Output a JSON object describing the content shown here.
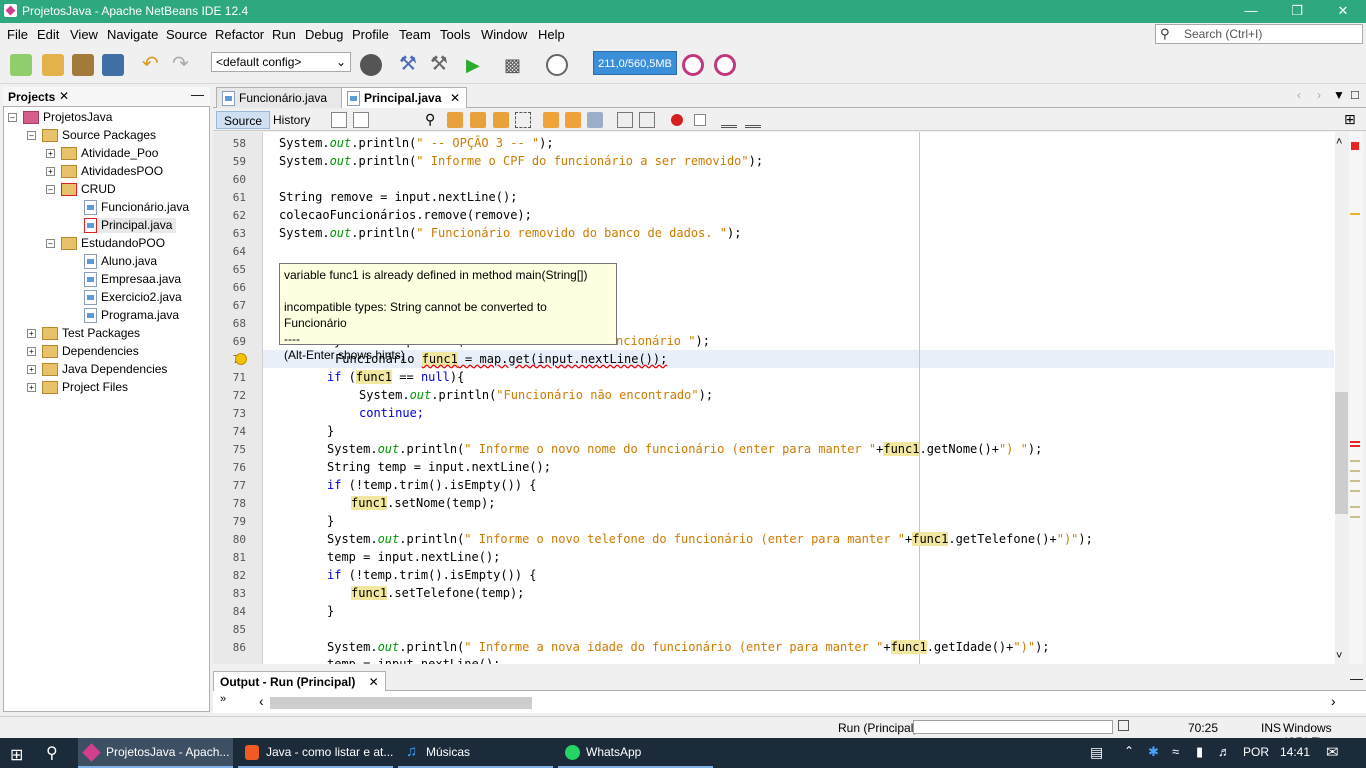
{
  "window": {
    "title": "ProjetosJava - Apache NetBeans IDE 12.4"
  },
  "menu": [
    "File",
    "Edit",
    "View",
    "Navigate",
    "Source",
    "Refactor",
    "Run",
    "Debug",
    "Profile",
    "Team",
    "Tools",
    "Window",
    "Help"
  ],
  "search": {
    "placeholder": "Search (Ctrl+I)"
  },
  "toolbar": {
    "config": "<default config>",
    "memory": "211,0/560,5MB"
  },
  "projects": {
    "tab_label": "Projects",
    "root": "ProjetosJava",
    "source_packages": "Source Packages",
    "packages": [
      "Atividade_Poo",
      "AtividadesPOO",
      "CRUD",
      "EstudandoPOO"
    ],
    "crud_files": [
      "Funcionário.java",
      "Principal.java"
    ],
    "estudando_files": [
      "Aluno.java",
      "Empresaa.java",
      "Exercicio2.java",
      "Programa.java"
    ],
    "others": [
      "Test Packages",
      "Dependencies",
      "Java Dependencies",
      "Project Files"
    ]
  },
  "editor": {
    "tabs": [
      "Funcionário.java",
      "Principal.java"
    ],
    "source_label": "Source",
    "history_label": "History"
  },
  "code": {
    "l58a": "System.",
    "l58b": "out",
    "l58c": ".println(",
    "l58d": "\" -- OPÇÃO 3 -- \"",
    "l58e": ");",
    "l59a": "System.",
    "l59b": "out",
    "l59c": ".println(",
    "l59d": "\" Informe o CPF do funcionário a ser removido\"",
    "l59e": ");",
    "l61": "String remove = input.nextLine();",
    "l62": "colecaoFuncionários.remove(remove);",
    "l63a": "System.",
    "l63b": "out",
    "l63c": ".println(",
    "l63d": "\" Funcionário removido do banco de dados. \"",
    "l63e": ");",
    "l69a": "System.out.println(",
    "l69b": "\" Informe o cod do funcionário \"",
    "l69c": ");",
    "l70a": "Funcionário ",
    "l70b": "func1",
    "l70c": " = map.get(input.nextLine());",
    "l71a": "if",
    "l71b": " (",
    "l71c": "func1",
    "l71d": " == ",
    "l71e": "null",
    "l71f": "){",
    "l72a": "System.",
    "l72b": "out",
    "l72c": ".println(",
    "l72d": "\"Funcionário não encontrado\"",
    "l72e": ");",
    "l73": "continue;",
    "l74": "}",
    "l75a": "System.",
    "l75b": "out",
    "l75c": ".println(",
    "l75d": "\" Informe o novo nome do funcionário (enter para manter \"",
    "l75e": "+",
    "l75f": "func1",
    "l75g": ".getNome()+",
    "l75h": "\") \"",
    "l75i": ");",
    "l76": "String temp = input.nextLine();",
    "l77a": "if",
    "l77b": " (!temp.trim().isEmpty()) {",
    "l78a": "func1",
    "l78b": ".setNome(temp);",
    "l79": "}",
    "l80a": "System.",
    "l80b": "out",
    "l80c": ".println(",
    "l80d": "\" Informe o novo telefone do funcionário (enter para manter \"",
    "l80e": "+",
    "l80f": "func1",
    "l80g": ".getTelefone()+",
    "l80h": "\")\"",
    "l80i": ");",
    "l81": "temp = input.nextLine();",
    "l82a": "if",
    "l82b": " (!temp.trim().isEmpty()) {",
    "l83a": "func1",
    "l83b": ".setTelefone(temp);",
    "l84": "}",
    "l86a": "System.",
    "l86b": "out",
    "l86c": ".println(",
    "l86d": "\" Informe a nova idade do funcionário (enter para manter \"",
    "l86e": "+",
    "l86f": "func1",
    "l86g": ".getIdade()+",
    "l86h": "\")\"",
    "l86i": ");",
    "l87": "temp = input.nextLine();"
  },
  "line_numbers": [
    "58",
    "59",
    "60",
    "61",
    "62",
    "63",
    "64",
    "65",
    "66",
    "67",
    "68",
    "69",
    "70",
    "71",
    "72",
    "73",
    "74",
    "75",
    "76",
    "77",
    "78",
    "79",
    "80",
    "81",
    "82",
    "83",
    "84",
    "85",
    "86"
  ],
  "tooltip": {
    "line1": "variable func1 is already defined in method main(String[])",
    "line2": "incompatible types: String cannot be converted to Funcionário",
    "line3": "----",
    "line4": "(Alt-Enter shows hints)"
  },
  "output": {
    "tab_label": "Output - Run (Principal)"
  },
  "status": {
    "run": "Run (Principal)",
    "position": "70:25",
    "mode": "INS",
    "line_ending": "Windows (CRLF)"
  },
  "taskbar": {
    "items": [
      "ProjetosJava - Apach...",
      "Java - como listar e at...",
      "Músicas",
      "WhatsApp"
    ],
    "language": "POR",
    "time": "14:41"
  }
}
